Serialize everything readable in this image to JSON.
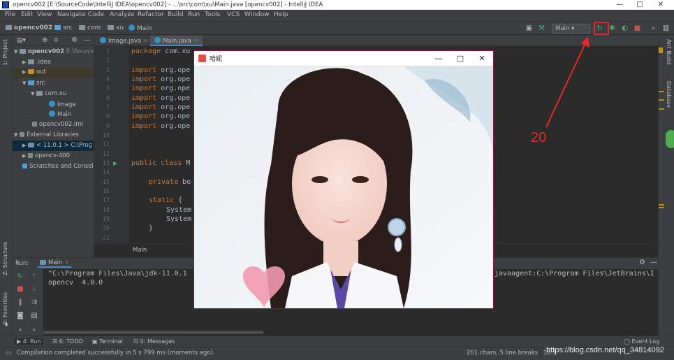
{
  "window": {
    "title": "opencv002 [E:\\SourceCode\\IntelliJ IDEA\\opencv002] - ...\\src\\com\\xu\\Main.java [opencv002] - IntelliJ IDEA",
    "minimize": "—",
    "maximize": "□",
    "close": "✕"
  },
  "menu": [
    "File",
    "Edit",
    "View",
    "Navigate",
    "Code",
    "Analyze",
    "Refactor",
    "Build",
    "Run",
    "Tools",
    "VCS",
    "Window",
    "Help"
  ],
  "breadcrumbs": [
    "opencv002",
    "src",
    "com",
    "xu",
    "Main"
  ],
  "toolbar": {
    "run_config": "Main",
    "run_config_arrow": "▾"
  },
  "left_tabs": {
    "project": "1: Project",
    "structure": "Z: Structure",
    "favorites": "2: Favorites"
  },
  "right_tabs": {
    "ant": "Ant Build",
    "database": "Database"
  },
  "project_tree": {
    "root_name": "opencv002",
    "root_path": "E:\\Source",
    "idea": ".idea",
    "out": "out",
    "src": "src",
    "pkg": "com.xu",
    "image": "Image",
    "main": "Main",
    "iml": "opencv002.iml",
    "ext_libs": "External Libraries",
    "jdk": "< 11.0.1 >  C:\\Prog",
    "opencv_lib": "opencv-400",
    "scratches": "Scratches and Consol"
  },
  "editor": {
    "tabs": [
      "Image.java",
      "Main.java"
    ],
    "line_numbers": [
      "1",
      "2",
      "3",
      "4",
      "5",
      "6",
      "7",
      "8",
      "9",
      "10",
      "11",
      "12",
      "13",
      "14",
      "15",
      "16",
      "17",
      "18",
      "19",
      "20",
      "21"
    ],
    "code": {
      "l1_kw": "package",
      "l1_rest": " com.xu",
      "imp_kw": "import",
      "imp_rest": " org.ope",
      "l13_kw": "public class",
      "l13_rest": " M",
      "l15_kw": "private",
      "l15_rest": " bo",
      "l17_kw": "static",
      "l17_rest": " {",
      "sys": "System",
      "close_brace": "}"
    },
    "footer_crumb": "Main"
  },
  "run_panel": {
    "label": "Run:",
    "tab": "Main",
    "line1_left": "\"C:\\Program Files\\Java\\jdk-11.0.1",
    "line1_right": "javaagent:C:\\Program Files\\JetBrains\\I",
    "line2": "opencv  4.0.0"
  },
  "bottom_tabs": {
    "run": "4: Run",
    "todo": "6: TODO",
    "terminal": "Terminal",
    "messages": "0: Messages",
    "event_log": "Event Log"
  },
  "status": {
    "message": "Compilation completed successfully in 5 s 799 ms (moments ago)",
    "chars": "201 chars, 5 line breaks",
    "pos": "16:1"
  },
  "photo_window": {
    "title": "哈妮"
  },
  "annotation": {
    "number": "20",
    "color": "#e8272a"
  },
  "watermark": "https://blog.csdn.net/qq_34814092",
  "colors": {
    "bg": "#2b2b2b",
    "panel": "#3c3f41",
    "keyword": "#cc7832",
    "text": "#a9b7c6"
  }
}
